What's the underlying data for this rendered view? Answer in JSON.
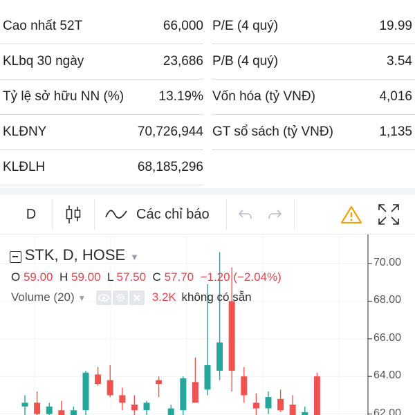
{
  "stats": {
    "left": [
      {
        "label": "Cao nhất 52T",
        "value": "66,000"
      },
      {
        "label": "KLbq 30 ngày",
        "value": "23,686"
      },
      {
        "label": "Tỷ lệ sở hữu NN (%)",
        "value": "13.19%"
      },
      {
        "label": "KLĐNY",
        "value": "70,726,944"
      },
      {
        "label": "KLĐLH",
        "value": "68,185,296"
      }
    ],
    "right": [
      {
        "label": "P/E (4 quý)",
        "value": "19.99"
      },
      {
        "label": "P/B (4 quý)",
        "value": "3.54"
      },
      {
        "label": "Vốn hóa (tỷ VNĐ)",
        "value": "4,016"
      },
      {
        "label": "GT sổ sách (tỷ VNĐ)",
        "value": "1,135"
      }
    ]
  },
  "toolbar": {
    "interval": "D",
    "indicators_label": "Các chỉ báo",
    "icons": [
      "candles-icon",
      "indicators-icon",
      "undo-icon",
      "redo-icon",
      "warning-icon",
      "fullscreen-icon"
    ],
    "warning_color": "#f0a30a"
  },
  "legend": {
    "symbol": "STK, D, HOSE",
    "open_label": "O",
    "open": "59.00",
    "high_label": "H",
    "high": "59.00",
    "low_label": "L",
    "low": "57.50",
    "close_label": "C",
    "close": "57.70",
    "change": "−1.20 (−2.04%)",
    "volume_label": "Volume (20)",
    "volume_value": "3.2K",
    "volume_status": "không có sẵn"
  },
  "colors": {
    "up": "#26a69a",
    "down": "#ef5350",
    "text_down": "#e0454f"
  },
  "chart_data": {
    "type": "candlestick",
    "y_ticks": [
      "70.00",
      "68.00",
      "66.00",
      "64.00",
      "62.00"
    ],
    "ylim": [
      61.5,
      72
    ],
    "candles": [
      {
        "o": 62.4,
        "h": 63.0,
        "l": 61.8,
        "c": 62.6
      },
      {
        "o": 62.6,
        "h": 63.2,
        "l": 61.6,
        "c": 62.0
      },
      {
        "o": 62.0,
        "h": 62.6,
        "l": 61.5,
        "c": 62.4
      },
      {
        "o": 62.2,
        "h": 62.7,
        "l": 61.6,
        "c": 61.8
      },
      {
        "o": 61.8,
        "h": 62.4,
        "l": 61.5,
        "c": 62.2
      },
      {
        "o": 62.2,
        "h": 64.3,
        "l": 61.9,
        "c": 64.2
      },
      {
        "o": 64.1,
        "h": 64.5,
        "l": 63.5,
        "c": 63.6
      },
      {
        "o": 63.8,
        "h": 64.6,
        "l": 62.9,
        "c": 63.0
      },
      {
        "o": 63.0,
        "h": 63.4,
        "l": 62.2,
        "c": 62.6
      },
      {
        "o": 62.5,
        "h": 63.0,
        "l": 61.8,
        "c": 62.2
      },
      {
        "o": 62.2,
        "h": 62.7,
        "l": 61.6,
        "c": 62.6
      },
      {
        "o": 63.8,
        "h": 64.0,
        "l": 62.9,
        "c": 63.6
      },
      {
        "o": 61.9,
        "h": 62.5,
        "l": 61.6,
        "c": 62.3
      },
      {
        "o": 62.2,
        "h": 64.0,
        "l": 61.9,
        "c": 63.9
      },
      {
        "o": 63.7,
        "h": 65.0,
        "l": 62.9,
        "c": 62.6
      },
      {
        "o": 63.3,
        "h": 68.9,
        "l": 63.0,
        "c": 64.6
      },
      {
        "o": 64.3,
        "h": 70.6,
        "l": 63.8,
        "c": 65.8
      },
      {
        "o": 68.0,
        "h": 69.8,
        "l": 63.2,
        "c": 64.3
      },
      {
        "o": 64.0,
        "h": 64.5,
        "l": 62.6,
        "c": 63.0
      },
      {
        "o": 62.6,
        "h": 63.1,
        "l": 61.9,
        "c": 62.3
      },
      {
        "o": 62.3,
        "h": 63.2,
        "l": 62.0,
        "c": 62.9
      },
      {
        "o": 62.8,
        "h": 63.3,
        "l": 62.1,
        "c": 62.2
      },
      {
        "o": 62.5,
        "h": 63.0,
        "l": 61.6,
        "c": 61.8
      },
      {
        "o": 61.8,
        "h": 62.4,
        "l": 61.5,
        "c": 62.1
      },
      {
        "o": 64.0,
        "h": 64.2,
        "l": 61.6,
        "c": 61.8
      }
    ]
  }
}
